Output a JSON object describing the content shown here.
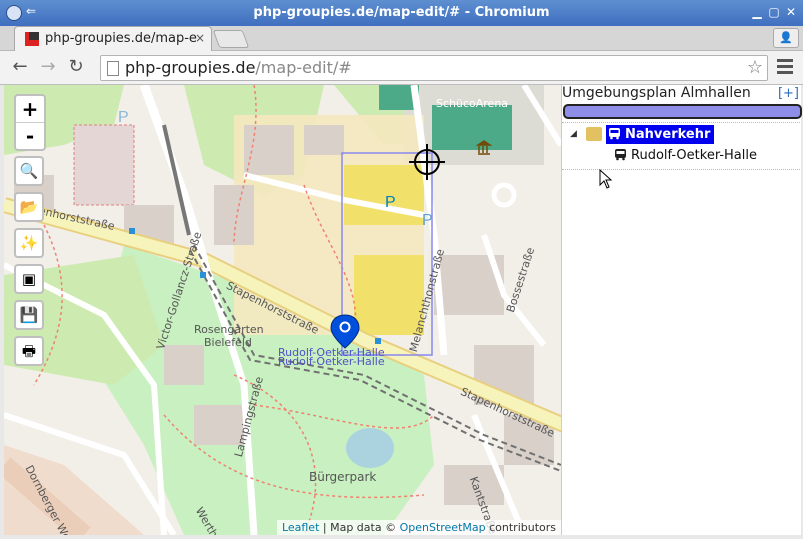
{
  "window": {
    "title": "php-groupies.de/map-edit/# - Chromium"
  },
  "tab": {
    "label": "php-groupies.de/map-e",
    "close": "×"
  },
  "address": {
    "host": "php-groupies.de",
    "path": "/map-edit/#"
  },
  "map": {
    "zoom_in": "+",
    "zoom_out": "-",
    "tools": {
      "search": "search-icon",
      "open": "folder-open-icon",
      "magic": "magic-wand-icon",
      "frame": "frame-icon",
      "save": "save-icon",
      "print": "print-icon"
    },
    "labels": {
      "rosengarten1": "Rosengarten",
      "rosengarten2": "Bielefeld",
      "stapen1": "Stapenhorststraße",
      "stapen2": "Stapenhorststraße",
      "stapen3": "Stapenhorststraße",
      "melanchthon": "Melanchthonstraße",
      "victor": "Victor-Gollancz-Straße",
      "buergerpark": "Bürgerpark",
      "lampingstr": "Lampingstraße",
      "bossestr": "Bossestraße",
      "kantstr": "Kantstraße",
      "dornbergerweg": "Dornberger Weg",
      "werther": "Werther",
      "schuco": "SchücoArena",
      "rudolf1": "Rudolf-Oetker-Halle",
      "rudolf2": "Rudolf-Oetker-Halle"
    },
    "attribution": {
      "leaflet": "Leaflet",
      "sep": " | Map data © ",
      "osm": "OpenStreetMap",
      "suffix": " contributors"
    }
  },
  "panel": {
    "title": "Umgebungsplan Almhallen",
    "add": "[+]",
    "progress": 1.0,
    "tree": {
      "group": "Nahverkehr",
      "item": "Rudolf-Oetker-Halle"
    }
  },
  "colors": {
    "accent": "#0000ee",
    "progress": "#8e8ee8",
    "marker": "#0050dd"
  }
}
